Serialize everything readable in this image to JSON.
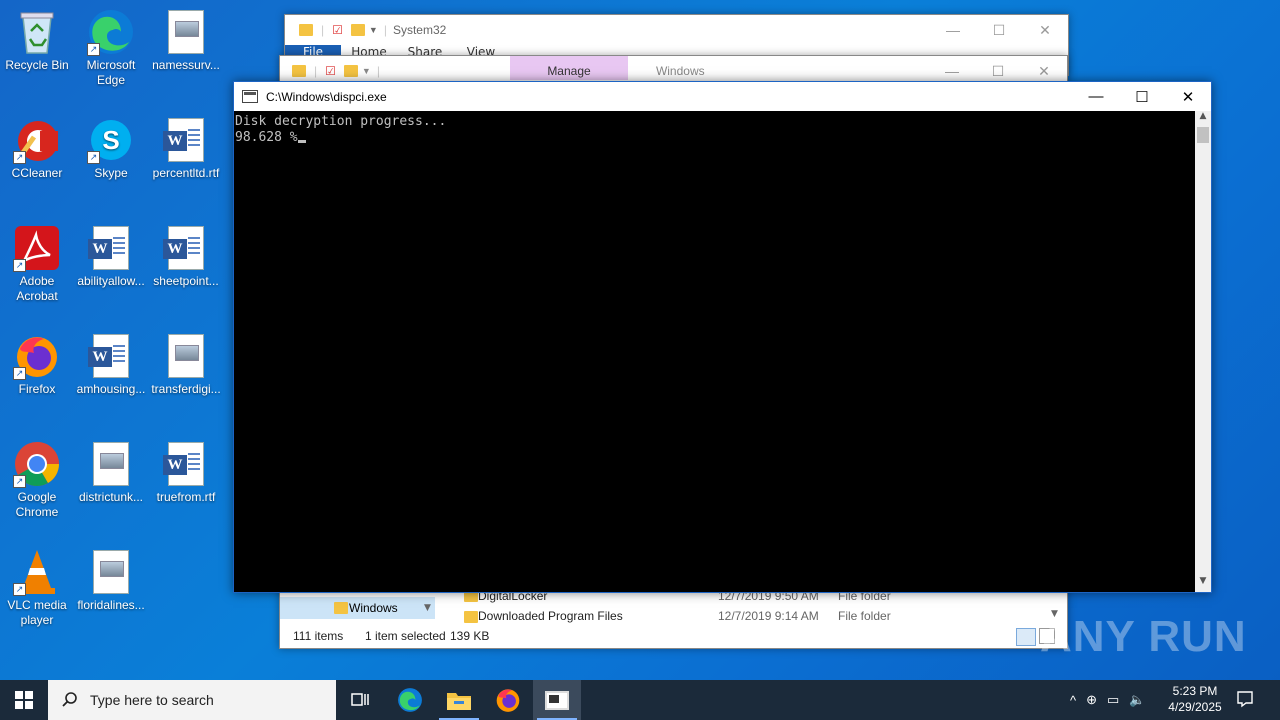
{
  "desktop": {
    "icons": [
      {
        "label": "Recycle Bin"
      },
      {
        "label": "Microsoft Edge"
      },
      {
        "label": "namessurv..."
      },
      {
        "label": "CCleaner"
      },
      {
        "label": "Skype"
      },
      {
        "label": "percentltd.rtf"
      },
      {
        "label": "Adobe Acrobat"
      },
      {
        "label": "abilityallow..."
      },
      {
        "label": "sheetpoint..."
      },
      {
        "label": "Firefox"
      },
      {
        "label": "amhousing..."
      },
      {
        "label": "transferdigi..."
      },
      {
        "label": "Google Chrome"
      },
      {
        "label": "districtunk..."
      },
      {
        "label": "truefrom.rtf"
      },
      {
        "label": "VLC media player"
      },
      {
        "label": "floridalines..."
      }
    ]
  },
  "explorer_back": {
    "title": "System32",
    "tabs": [
      "File",
      "Home",
      "Share",
      "View"
    ]
  },
  "explorer_front": {
    "title": "Windows",
    "manage_tab": "Manage",
    "nav_selected": "Windows",
    "files": [
      {
        "name": "DigitalLocker",
        "date": "12/7/2019 9:50 AM",
        "type": "File folder"
      },
      {
        "name": "Downloaded Program Files",
        "date": "12/7/2019 9:14 AM",
        "type": "File folder"
      }
    ],
    "status": {
      "items": "111 items",
      "selected": "1 item selected",
      "size": "139 KB"
    }
  },
  "console": {
    "title": "C:\\Windows\\dispci.exe",
    "line1": "Disk decryption progress...",
    "line2": "98.628 %"
  },
  "taskbar": {
    "search_placeholder": "Type here to search",
    "time": "5:23 PM",
    "date": "4/29/2025"
  },
  "watermark": "ANY RUN"
}
